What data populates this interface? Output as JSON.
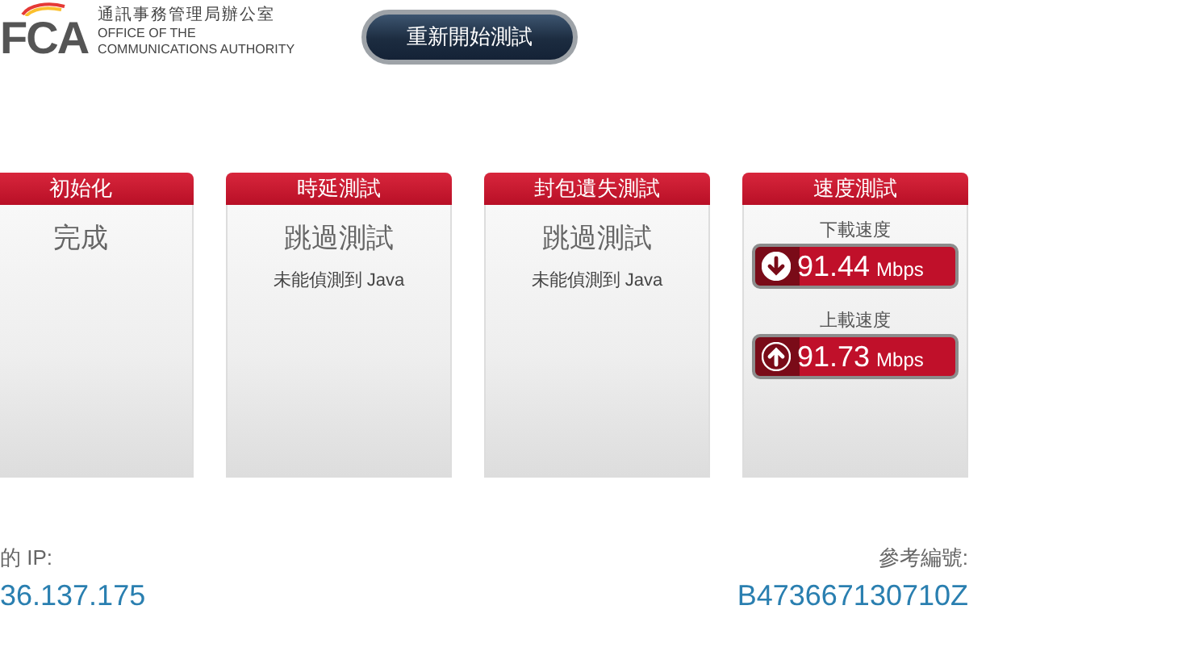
{
  "header": {
    "logo": {
      "mark": "FCA",
      "chinese": "通訊事務管理局辦公室",
      "english_1": "OFFICE OF THE",
      "english_2": "COMMUNICATIONS AUTHORITY"
    },
    "restart_button": "重新開始測試"
  },
  "cards": [
    {
      "kind": "status",
      "title": "初始化",
      "status": "完成"
    },
    {
      "kind": "status",
      "title": "時延測試",
      "status": "跳過測試",
      "note": "未能偵測到 Java"
    },
    {
      "kind": "status",
      "title": "封包遺失測試",
      "status": "跳過測試",
      "note": "未能偵測到 Java"
    },
    {
      "kind": "speed",
      "title": "速度測試",
      "results": [
        {
          "kind": "download",
          "label": "下載速度",
          "value": "91.44",
          "unit": "Mbps"
        },
        {
          "kind": "upload",
          "label": "上載速度",
          "value": "91.73",
          "unit": "Mbps"
        }
      ]
    }
  ],
  "footer": {
    "ip_label": "的 IP:",
    "ip_value": "36.137.175",
    "ref_label": "參考編號:",
    "ref_value": "B473667130710Z"
  }
}
